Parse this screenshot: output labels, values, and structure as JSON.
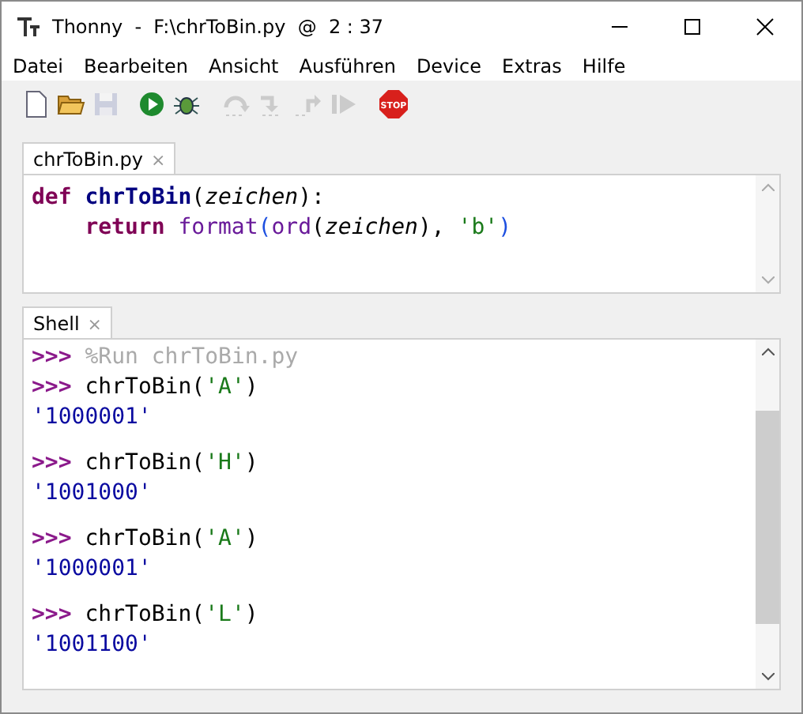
{
  "window": {
    "title": "Thonny  -  F:\\chrToBin.py  @  2 : 37"
  },
  "menu": [
    "Datei",
    "Bearbeiten",
    "Ansicht",
    "Ausführen",
    "Device",
    "Extras",
    "Hilfe"
  ],
  "toolbar": [
    {
      "buttons": [
        {
          "kind": "new",
          "disabled": false
        },
        {
          "kind": "open",
          "disabled": false
        },
        {
          "kind": "save",
          "disabled": true
        }
      ]
    },
    {
      "buttons": [
        {
          "kind": "run",
          "disabled": false
        },
        {
          "kind": "debug",
          "disabled": false
        }
      ]
    },
    {
      "buttons": [
        {
          "kind": "step-over",
          "disabled": true
        },
        {
          "kind": "step-into",
          "disabled": true
        },
        {
          "kind": "step-out",
          "disabled": true
        },
        {
          "kind": "resume",
          "disabled": true
        }
      ]
    },
    {
      "buttons": [
        {
          "kind": "stop",
          "disabled": false,
          "label": "STOP"
        }
      ]
    }
  ],
  "editor": {
    "tab": {
      "label": "chrToBin.py",
      "close": "×"
    },
    "lines": [
      {
        "indented": false,
        "tokens": [
          {
            "text": "def ",
            "kind": "keyword"
          },
          {
            "text": "chrToBin",
            "kind": "funcname"
          },
          {
            "text": "(",
            "kind": "plain"
          },
          {
            "text": "zeichen",
            "kind": "param"
          },
          {
            "text": "):",
            "kind": "plain"
          }
        ]
      },
      {
        "indented": true,
        "tokens": [
          {
            "text": "return ",
            "kind": "keyword"
          },
          {
            "text": "format",
            "kind": "builtin"
          },
          {
            "text": "(",
            "kind": "paren"
          },
          {
            "text": "ord",
            "kind": "builtin"
          },
          {
            "text": "(",
            "kind": "plain"
          },
          {
            "text": "zeichen",
            "kind": "param"
          },
          {
            "text": "), ",
            "kind": "plain"
          },
          {
            "text": "'b'",
            "kind": "string"
          },
          {
            "text": ")",
            "kind": "paren"
          }
        ]
      }
    ]
  },
  "shell": {
    "tab": {
      "label": "Shell",
      "close": "×"
    },
    "entries": [
      {
        "prompt": ">>>",
        "tokens": [
          {
            "text": "%Run chrToBin.py",
            "kind": "magic"
          }
        ]
      },
      {
        "prompt": ">>>",
        "tokens": [
          {
            "text": "chrToBin(",
            "kind": "plain"
          },
          {
            "text": "'A'",
            "kind": "string"
          },
          {
            "text": ")",
            "kind": "plain"
          }
        ],
        "output": "'1000001'"
      },
      {
        "prompt": ">>>",
        "tokens": [
          {
            "text": "chrToBin(",
            "kind": "plain"
          },
          {
            "text": "'H'",
            "kind": "string"
          },
          {
            "text": ")",
            "kind": "plain"
          }
        ],
        "output": "'1001000'"
      },
      {
        "prompt": ">>>",
        "tokens": [
          {
            "text": "chrToBin(",
            "kind": "plain"
          },
          {
            "text": "'A'",
            "kind": "string"
          },
          {
            "text": ")",
            "kind": "plain"
          }
        ],
        "output": "'1000001'"
      },
      {
        "prompt": ">>>",
        "tokens": [
          {
            "text": "chrToBin(",
            "kind": "plain"
          },
          {
            "text": "'L'",
            "kind": "string"
          },
          {
            "text": ")",
            "kind": "plain"
          }
        ],
        "output": "'1001100'"
      }
    ]
  }
}
